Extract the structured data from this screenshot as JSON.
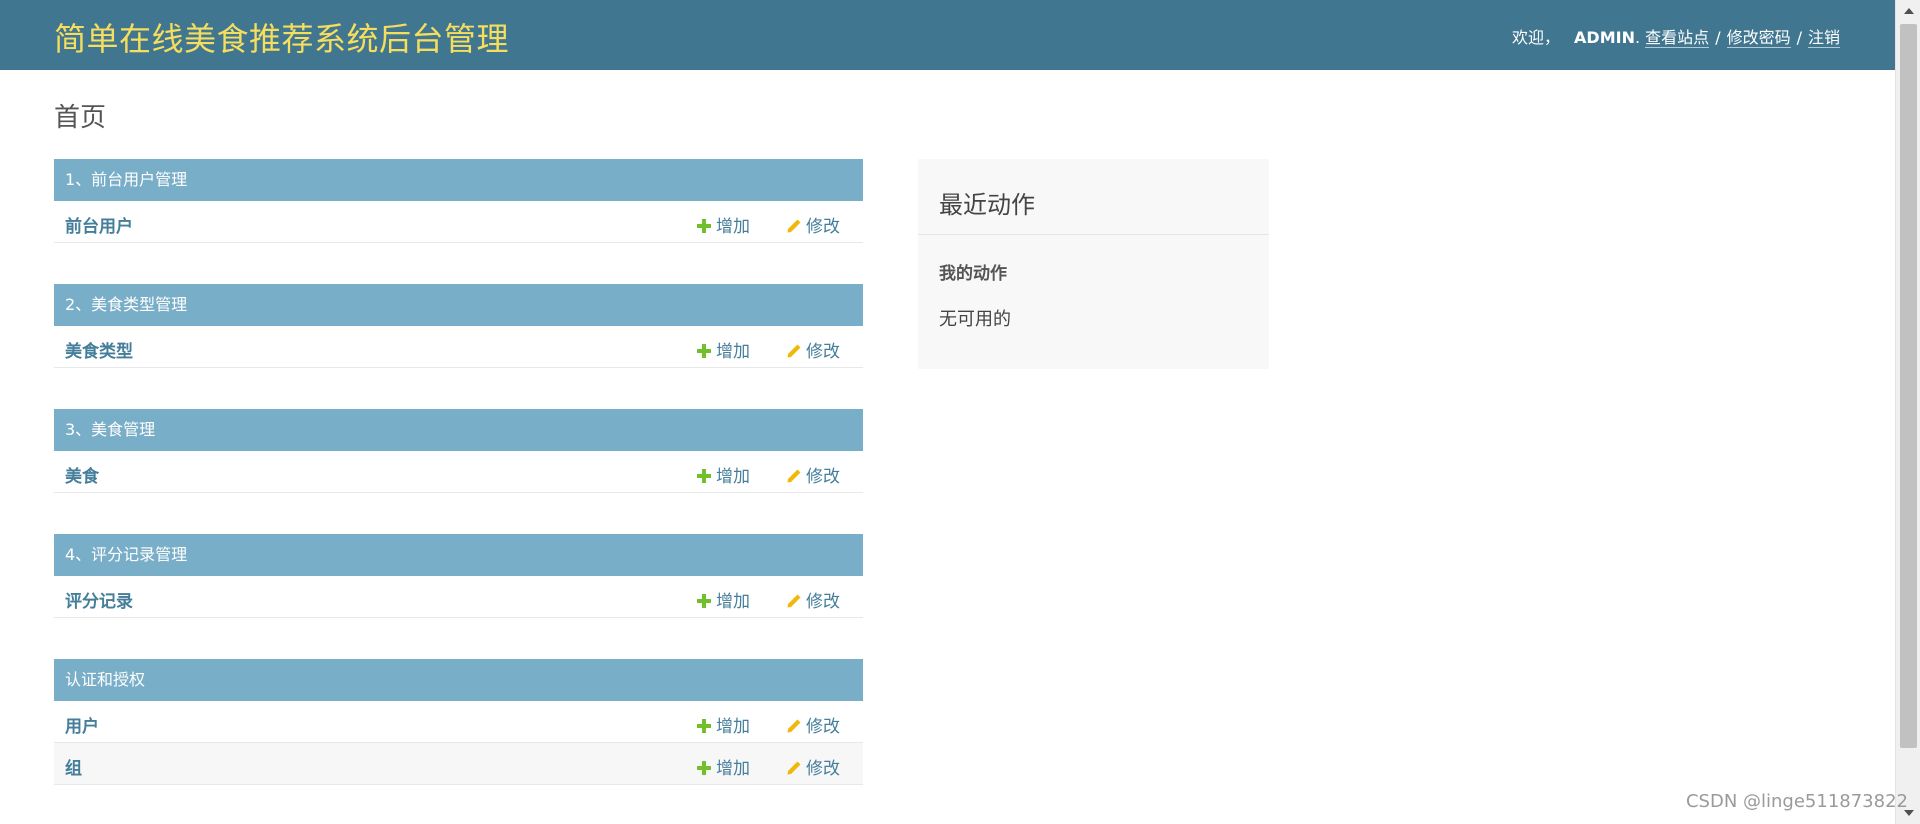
{
  "header": {
    "brand": "简单在线美食推荐系统后台管理",
    "welcome": "欢迎，",
    "username": "ADMIN",
    "period": ".",
    "view_site": "查看站点",
    "change_password": "修改密码",
    "logout": "注销",
    "separator": "/"
  },
  "page_title": "首页",
  "actions": {
    "add": "增加",
    "change": "修改"
  },
  "modules": [
    {
      "caption": "1、前台用户管理",
      "rows": [
        {
          "name": "前台用户"
        }
      ]
    },
    {
      "caption": "2、美食类型管理",
      "rows": [
        {
          "name": "美食类型"
        }
      ]
    },
    {
      "caption": "3、美食管理",
      "rows": [
        {
          "name": "美食"
        }
      ]
    },
    {
      "caption": "4、评分记录管理",
      "rows": [
        {
          "name": "评分记录"
        }
      ]
    },
    {
      "caption": "认证和授权",
      "rows": [
        {
          "name": "用户"
        },
        {
          "name": "组"
        }
      ]
    }
  ],
  "recent_actions": {
    "title": "最近动作",
    "subtitle": "我的动作",
    "empty": "无可用的"
  },
  "watermark": "CSDN @linge511873822",
  "colors": {
    "header_bg": "#417690",
    "brand": "#f5dd5d",
    "caption_bg": "#79aec8",
    "link": "#447e9b",
    "add_icon": "#70bf2b",
    "change_icon": "#efb80b"
  }
}
